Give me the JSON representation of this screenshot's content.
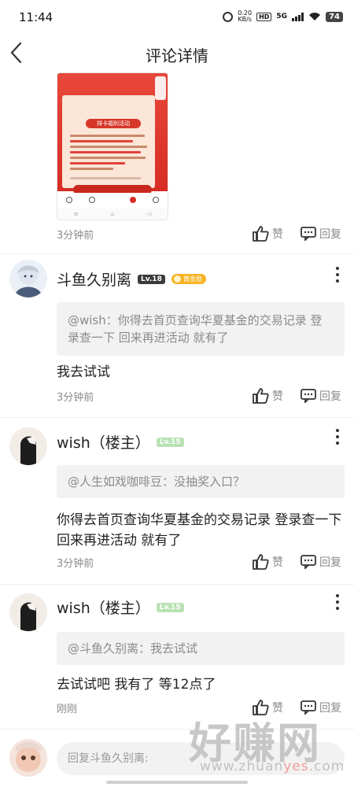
{
  "status_bar": {
    "time": "11:44",
    "net_speed": "0.20",
    "net_unit": "KB/s",
    "hd": "HD",
    "signal": "5G",
    "battery": "74"
  },
  "header": {
    "title": "评论详情"
  },
  "top_comment": {
    "image_title": "排卡福利活动",
    "time": "3分钟前",
    "like_label": "赞",
    "reply_label": "回复"
  },
  "comments": [
    {
      "username": "斗鱼久别离",
      "level": "Lv.18",
      "medal": "黄金勋",
      "quote": "@wish：你得去首页查询华夏基金的交易记录 登录查一下 回来再进活动 就有了",
      "text": "我去试试",
      "time": "3分钟前",
      "like_label": "赞",
      "reply_label": "回复"
    },
    {
      "username": "wish（楼主）",
      "level": "Lv.15",
      "quote": "@人生如戏咖啡豆：没抽奖入口？",
      "text": "你得去首页查询华夏基金的交易记录 登录查一下 回来再进活动 就有了",
      "time": "3分钟前",
      "like_label": "赞",
      "reply_label": "回复"
    },
    {
      "username": "wish（楼主）",
      "level": "Lv.15",
      "quote": "@斗鱼久别离：我去试试",
      "text": "去试试吧 我有了 等12点了",
      "time": "刚刚",
      "like_label": "赞",
      "reply_label": "回复"
    }
  ],
  "reply_input": {
    "placeholder": "回复斗鱼久别离:"
  },
  "watermark": {
    "logo": "好赚网",
    "url_a": "www.zhuan",
    "url_b": "yes",
    "url_c": ".com"
  }
}
